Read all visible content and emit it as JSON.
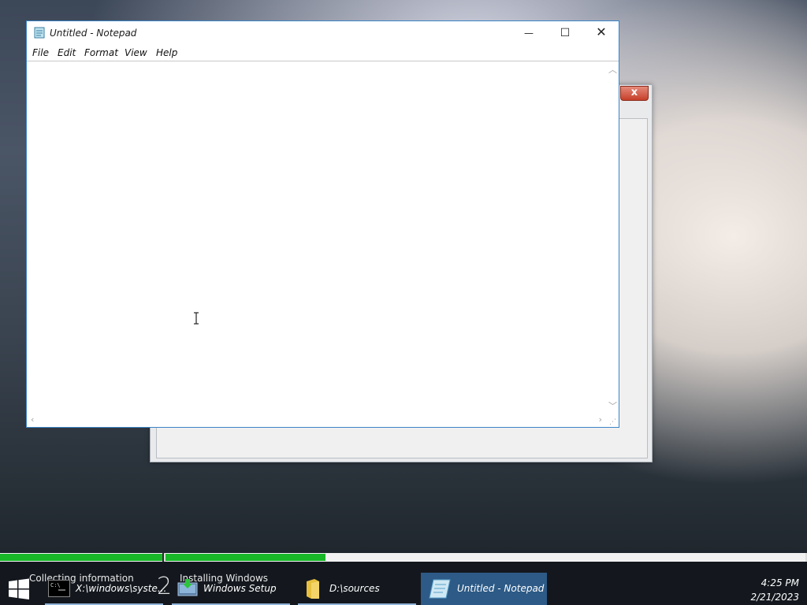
{
  "notepad": {
    "title": "Untitled - Notepad",
    "controls": {
      "minimize": "—",
      "maximize": "☐",
      "close": "✕"
    },
    "menu": [
      "File",
      "Edit",
      "Format",
      "View",
      "Help"
    ],
    "content": ""
  },
  "background_dialog": {
    "close": "x"
  },
  "setup_progress": {
    "phases": [
      {
        "label": "Collecting information",
        "progress": 1.0
      },
      {
        "number": "2",
        "label": "Installing Windows",
        "progress": 0.25
      }
    ],
    "fill_color": "#18b828"
  },
  "taskbar": {
    "items": [
      {
        "label": "X:\\windows\\syste...",
        "icon": "cmd-icon"
      },
      {
        "label": "Windows Setup",
        "icon": "setup-icon"
      },
      {
        "label": "D:\\sources",
        "icon": "folder-icon"
      },
      {
        "label": "Untitled - Notepad",
        "icon": "notepad-icon",
        "active": true
      }
    ],
    "clock": {
      "time": "4:25 PM",
      "date": "2/21/2023"
    }
  }
}
